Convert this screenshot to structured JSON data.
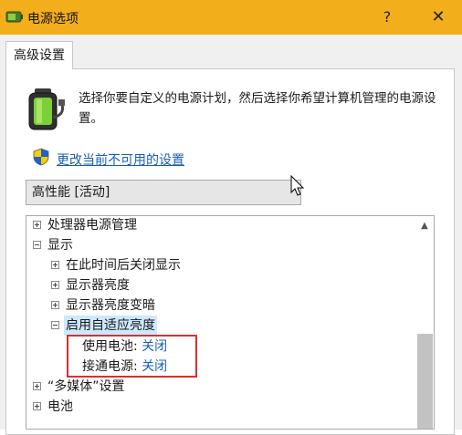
{
  "window": {
    "title": "电源选项",
    "help_glyph": "?",
    "close_glyph": "✕"
  },
  "tab": {
    "label": "高级设置"
  },
  "description": "选择你要自定义的电源计划，然后选择你希望计算机管理的电源设置。",
  "change_link": "更改当前不可用的设置",
  "plan_select": {
    "value": "高性能 [活动]"
  },
  "tree": {
    "processor": "处理器电源管理",
    "display": "显示",
    "turn_off_display": "在此时间后关闭显示",
    "display_brightness": "显示器亮度",
    "dimmed_brightness": "显示器亮度变暗",
    "adaptive_brightness": "启用自适应亮度",
    "on_battery_label": "使用电池:",
    "on_battery_value": "关闭",
    "plugged_in_label": "接通电源:",
    "plugged_in_value": "关闭",
    "multimedia": "“多媒体”设置",
    "battery": "电池"
  },
  "colors": {
    "title_bar": "#f2ae1b",
    "link": "#1a5fb4",
    "highlight": "#cde8ff",
    "annotation_box": "#d8302f"
  },
  "icons": [
    "power-options-app-icon",
    "battery-plug-icon",
    "uac-shield-icon",
    "mouse-cursor-icon"
  ]
}
